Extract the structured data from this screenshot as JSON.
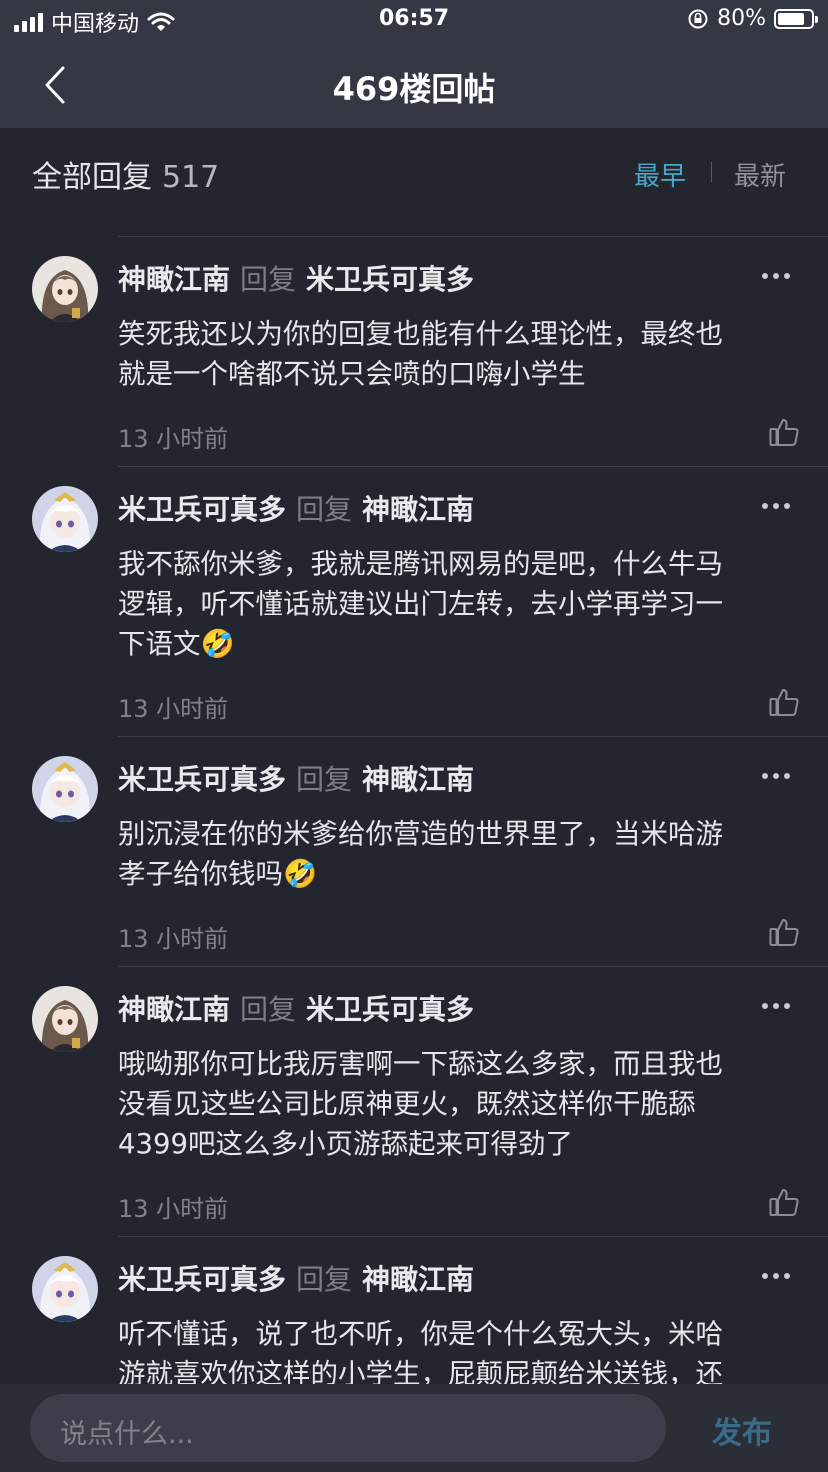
{
  "status_bar": {
    "carrier": "中国移动",
    "time": "06:57",
    "battery": "80%",
    "battery_level": 0.8
  },
  "nav": {
    "title": "469楼回帖"
  },
  "replies_header": {
    "title": "全部回复",
    "count": "517",
    "sort_earliest": "最早",
    "sort_latest": "最新",
    "active_sort": "earliest"
  },
  "reply_word": "回复",
  "comments": [
    {
      "author": "神瞰江南",
      "reply_to": "米卫兵可真多",
      "avatar": "dark-hair-avatar",
      "lines": [
        "笑死我还以为你的回复也能有什么理论性，最终也",
        "就是一个啥都不说只会喷的口嗨小学生"
      ],
      "emoji": "",
      "time": "13 小时前"
    },
    {
      "author": "米卫兵可真多",
      "reply_to": "神瞰江南",
      "avatar": "white-hair-avatar",
      "lines": [
        "我不舔你米爹，我就是腾讯网易的是吧，什么牛马",
        "逻辑，听不懂话就建议出门左转，去小学再学习一",
        "下语文"
      ],
      "emoji": "🤣",
      "time": "13 小时前"
    },
    {
      "author": "米卫兵可真多",
      "reply_to": "神瞰江南",
      "avatar": "white-hair-avatar",
      "lines": [
        "别沉浸在你的米爹给你营造的世界里了，当米哈游",
        "孝子给你钱吗"
      ],
      "emoji": "🤣",
      "time": "13 小时前"
    },
    {
      "author": "神瞰江南",
      "reply_to": "米卫兵可真多",
      "avatar": "dark-hair-avatar",
      "lines": [
        "哦呦那你可比我厉害啊一下舔这么多家，而且我也",
        "没看见这些公司比原神更火，既然这样你干脆舔",
        "4399吧这么多小页游舔起来可得劲了"
      ],
      "emoji": "",
      "time": "13 小时前"
    },
    {
      "author": "米卫兵可真多",
      "reply_to": "神瞰江南",
      "avatar": "white-hair-avatar",
      "lines": [
        "听不懂话，说了也不听，你是个什么冤大头，米哈",
        "游就喜欢你这样的小学生，屁颠屁颠给米送钱，还"
      ],
      "emoji": "",
      "time": ""
    }
  ],
  "input": {
    "placeholder": "说点什么...",
    "publish": "发布"
  },
  "colors": {
    "background": "#23252f",
    "bar": "#343744",
    "accent": "#49a7c9",
    "publish": "#3a6c88"
  }
}
